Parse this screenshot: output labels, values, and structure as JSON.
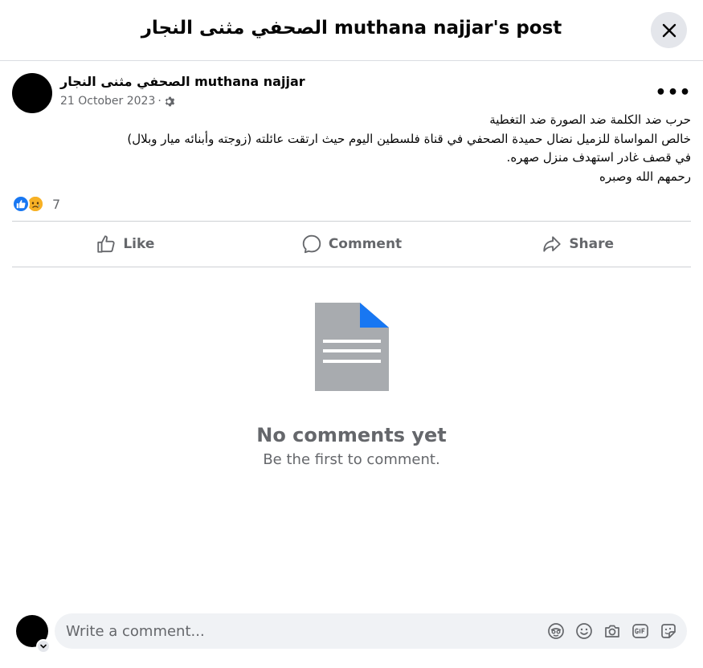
{
  "dialog": {
    "title": "الصحفي مثنى النجار muthana najjar's post"
  },
  "post": {
    "author": "الصحفي مثنى النجار muthana najjar",
    "date": "21 October 2023",
    "separator": "·",
    "audience_icon": "gear-icon",
    "more_label": "•••",
    "text_lines": [
      "حرب ضد الكلمة ضد الصورة ضد التغطية",
      "خالص المواساة للزميل نضال حميدة الصحفي في قناة فلسطين اليوم حيث ارتقت عائلته (زوجته وأبنائه ميار وبلال)",
      "في قصف غادر استهدف منزل صهره.",
      "رحمهم الله وصبره"
    ],
    "reactions": {
      "types": [
        "like",
        "sad"
      ],
      "count": "7"
    }
  },
  "actions": {
    "like": "Like",
    "comment": "Comment",
    "share": "Share"
  },
  "comments": {
    "empty_title": "No comments yet",
    "empty_subtitle": "Be the first to comment."
  },
  "composer": {
    "placeholder": "Write a comment...",
    "icons": [
      "avatar-sticker-icon",
      "emoji-icon",
      "camera-icon",
      "gif-icon",
      "sticker-icon"
    ]
  },
  "colors": {
    "accent": "#1877f2",
    "secondary_text": "#65676b",
    "divider": "#ced0d4",
    "button_bg": "#e4e6eb",
    "doc_gray": "#a8abaf"
  }
}
